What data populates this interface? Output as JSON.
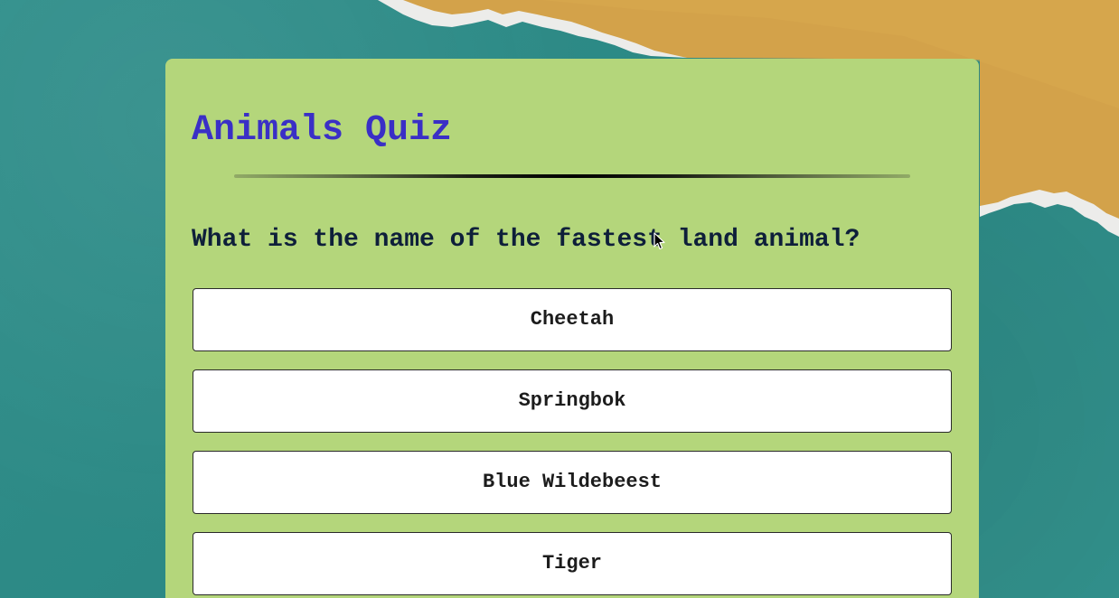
{
  "quiz": {
    "title": "Animals Quiz",
    "question": "What is the name of the fastest land animal?",
    "answers": [
      {
        "label": "Cheetah"
      },
      {
        "label": "Springbok"
      },
      {
        "label": "Blue Wildebeest"
      },
      {
        "label": "Tiger"
      }
    ]
  },
  "theme": {
    "background_color": "#2f8e8a",
    "paper_color": "#d3a24a",
    "card_color": "#b4d67b",
    "title_color": "#3a2fc6",
    "question_color": "#0e1f3a",
    "answer_background": "#ffffff"
  },
  "icons": {
    "pointer": "mouse-pointer-icon"
  }
}
